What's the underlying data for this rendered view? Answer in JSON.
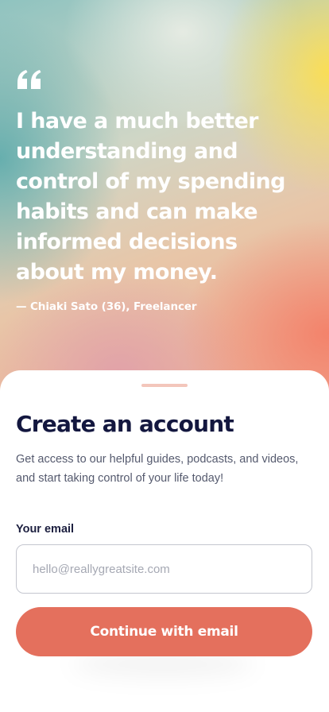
{
  "hero": {
    "quote_icon": "quote-icon",
    "quote": "I have a much better understanding and control of my spending habits and can make informed decisions about my money.",
    "author": "— Chiaki Sato (36), Freelancer"
  },
  "signup": {
    "title": "Create an account",
    "subtitle": "Get access to our helpful guides, podcasts, and videos, and start taking control of your life today!",
    "email_label": "Your email",
    "email_placeholder": "hello@reallygreatsite.com",
    "email_value": "",
    "continue_label": "Continue with email"
  },
  "colors": {
    "accent": "#e4705d",
    "title": "#13173f",
    "handle": "#f3c6bb"
  }
}
